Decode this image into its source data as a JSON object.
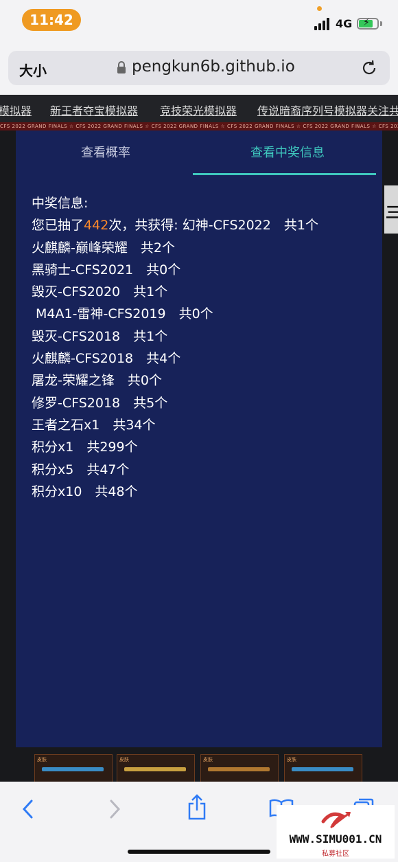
{
  "status_bar": {
    "time": "11:42",
    "network": "4G"
  },
  "address_bar": {
    "text_size_label": "大小",
    "url": "pengkun6b.github.io"
  },
  "nav_links": [
    "模拟器",
    "新王者夺宝模拟器",
    "竞技荣光模拟器",
    "传说暗裔序列号模拟器关注共"
  ],
  "banner": {
    "text": "CFS 2022 GRAND FINALS ☆ CFS 2022 GRAND FINALS ☆ CFS 2022 GRAND FINALS ☆ CFS 2022 GRAND FINALS ☆ CFS 2022 GRAND FINALS ☆ CFS 2022 GRAND FINALS ☆"
  },
  "side_widget": {
    "label": "三"
  },
  "modal": {
    "tabs": [
      {
        "label": "查看概率",
        "active": false
      },
      {
        "label": "查看中奖信息",
        "active": true
      }
    ],
    "heading": "中奖信息:",
    "summary": {
      "prefix": "您已抽了",
      "count": "442",
      "suffix": "次，共获得: 幻神-CFS2022　共1个"
    },
    "prizes": [
      "火麒麟-巅峰荣耀　共2个",
      "黑骑士-CFS2021　共0个",
      "毁灭-CFS2020　共1个",
      " M4A1-雷神-CFS2019　共0个",
      "毁灭-CFS2018　共1个",
      "火麒麟-CFS2018　共4个",
      "屠龙-荣耀之锋　共0个",
      "修罗-CFS2018　共5个",
      "王者之石x1　共34个",
      "积分x1　共299个",
      "积分x5　共47个",
      "积分x10　共48个"
    ]
  },
  "cards": [
    {
      "tag": "皮肤"
    },
    {
      "tag": "皮肤"
    },
    {
      "tag": "皮肤"
    },
    {
      "tag": "皮肤"
    }
  ],
  "watermark": {
    "site": "WWW.SIMU001.CN",
    "sub": "私募社区"
  },
  "colors": {
    "accent": "#3fc8be",
    "highlight": "#ff8a2a",
    "modal_bg": "#172259"
  }
}
